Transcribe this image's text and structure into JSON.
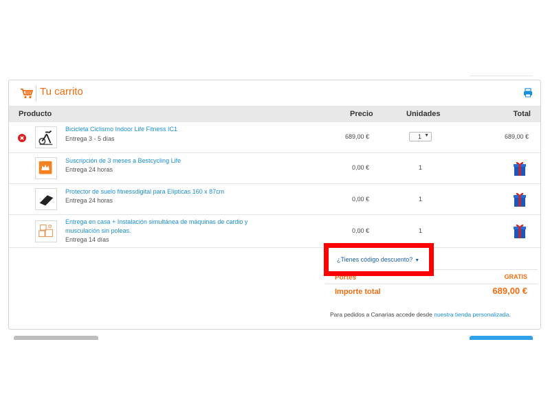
{
  "cart": {
    "title": "Tu carrito",
    "columns": {
      "producto": "Producto",
      "precio": "Precio",
      "unidades": "Unidades",
      "total": "Total"
    },
    "items": [
      {
        "name": "Bicicleta Ciclismo Indoor Life Fitness IC1",
        "delivery": "Entrega 3 - 5 días",
        "price": "689,00 €",
        "units": "1",
        "total": "689,00 €",
        "thumbnail_icon": "bike-icon"
      },
      {
        "name": "Suscripción de 3 meses a Bestcycling Life",
        "delivery": "Entrega 24 horas",
        "price": "0,00 €",
        "units": "1",
        "total_icon": "gift-icon",
        "thumbnail_icon": "crown-logo-icon"
      },
      {
        "name": "Protector de suelo fitnessdigital para Elípticas 160 x 87cm",
        "delivery": "Entrega 24 horas",
        "price": "0,00 €",
        "units": "1",
        "total_icon": "gift-icon",
        "thumbnail_icon": "floor-mat-icon"
      },
      {
        "name_line1": "Entrega en casa + Instalación simultánea de máquinas de cardio y",
        "name_line2": "musculación sin poleas.",
        "delivery": "Entrega 14 días",
        "price": "0,00 €",
        "units": "1",
        "total_icon": "gift-icon",
        "thumbnail_icon": "delivery-boxes-icon"
      }
    ]
  },
  "discount": {
    "label": "¿Tienes código descuento?"
  },
  "summary": {
    "portes_label": "Portes",
    "portes_value": "GRATIS",
    "importe_label": "Importe total",
    "importe_value": "689,00 €"
  },
  "canarias": {
    "text": "Para pedidos a Canarias accede desde ",
    "link": "nuestra tienda personalizada",
    "end": "."
  },
  "colors": {
    "accent_orange": "#f26c10",
    "link_blue": "#1a8fd6",
    "highlight_red": "#ff0000"
  }
}
